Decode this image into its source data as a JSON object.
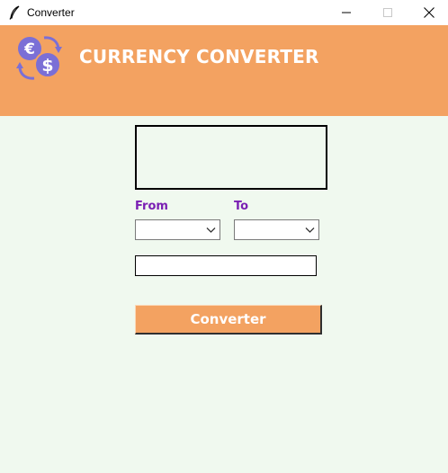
{
  "window": {
    "title": "Converter",
    "app_icon": "feather-icon",
    "controls": [
      "minimize-icon",
      "maximize-icon",
      "close-icon"
    ]
  },
  "header": {
    "title": "CURRENCY CONVERTER",
    "logo_icon": "currency-exchange-icon",
    "background_color": "#f3a261",
    "title_color": "#ffffff"
  },
  "main": {
    "background_color": "#f0f9ef",
    "result_text": "",
    "from_label": "From",
    "to_label": "To",
    "label_color": "#7a1fb3",
    "from_value": "",
    "to_value": "",
    "amount_value": "",
    "convert_label": "Converter",
    "button_color": "#f3a261"
  }
}
